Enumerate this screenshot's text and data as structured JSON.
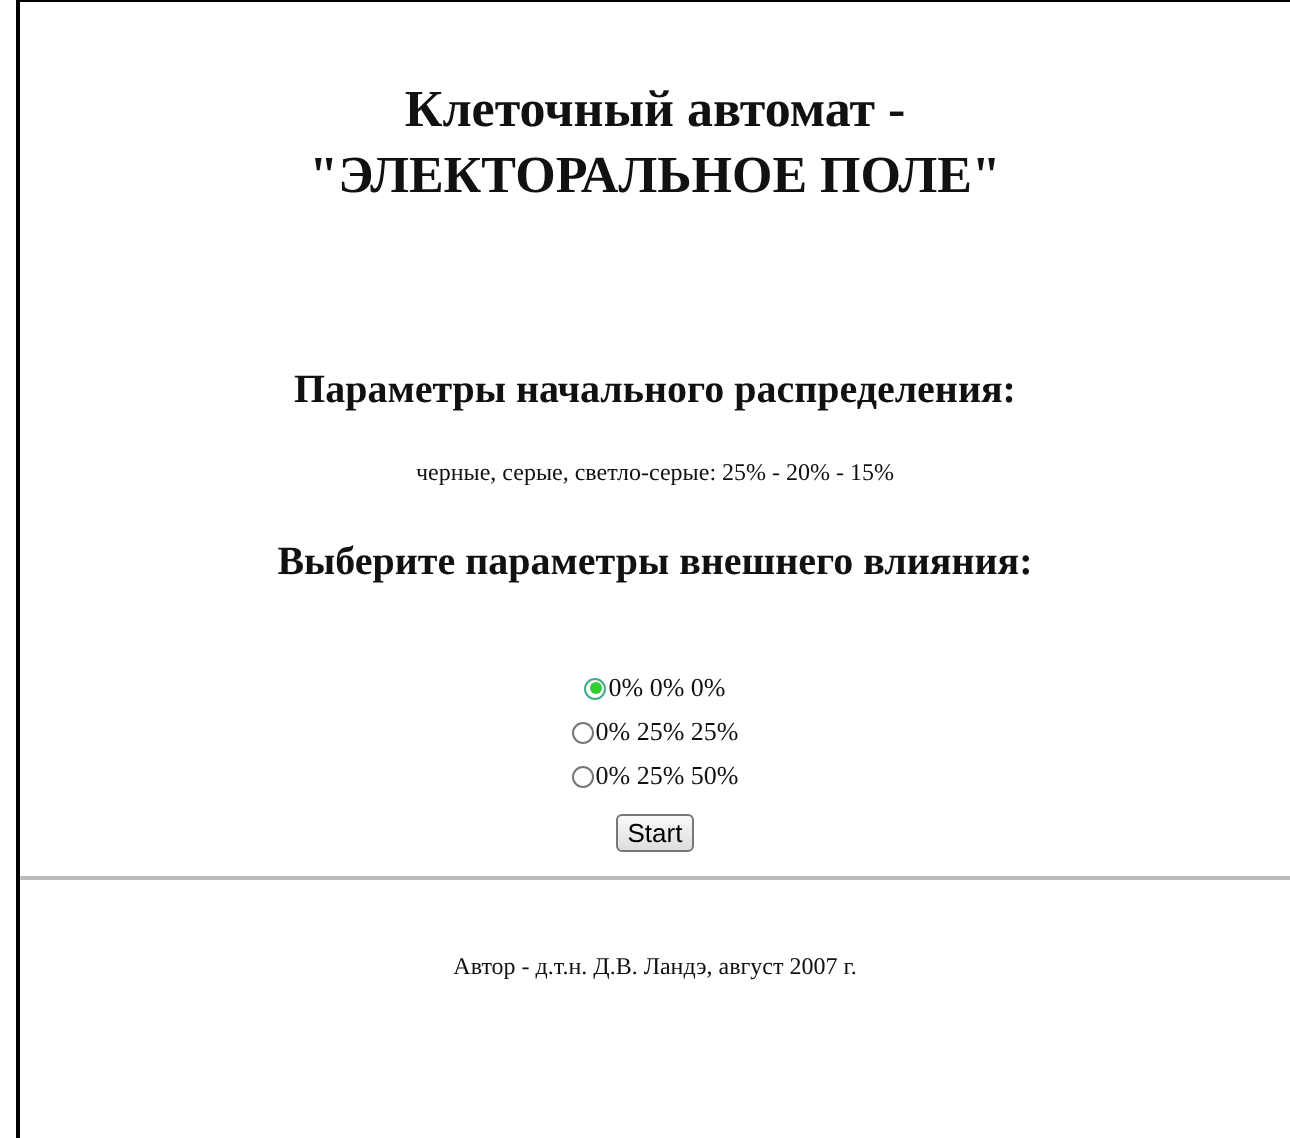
{
  "title_lines": [
    "Клеточный автомат -",
    "\"ЭЛЕКТОРАЛЬНОЕ ПОЛЕ\""
  ],
  "initial_heading": "Параметры начального распределения:",
  "initial_text": "черные, серые, светло-серые: 25% - 20% - 15%",
  "influence_heading": "Выберите параметры внешнего влияния:",
  "options": [
    {
      "label": "0% 0% 0%",
      "selected": true
    },
    {
      "label": "0% 25% 25%",
      "selected": false
    },
    {
      "label": "0% 25% 50%",
      "selected": false
    }
  ],
  "start_button": "Start",
  "footer": "Автор - д.т.н. Д.В. Ландэ, август 2007 г."
}
